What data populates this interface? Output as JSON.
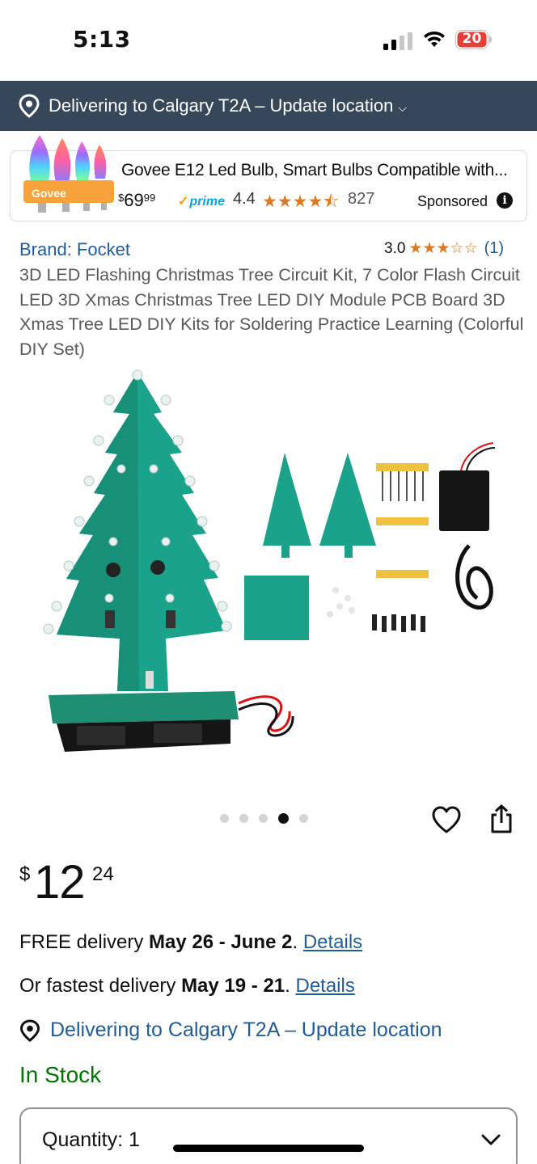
{
  "status_bar": {
    "time": "5:13",
    "battery": "20",
    "icons": [
      "signal-icon",
      "wifi-icon",
      "battery-icon"
    ]
  },
  "location_bar": {
    "text": "Delivering to Calgary T2A – Update location",
    "icon": "location-pin-icon"
  },
  "sponsored_ad": {
    "title": "Govee E12 Led Bulb, Smart Bulbs Compatible with...",
    "price_symbol": "$",
    "price_whole": "69",
    "price_cents": "99",
    "prime": "prime",
    "rating": "4.4",
    "stars": "★★★★⯪",
    "review_count": "827",
    "label": "Sponsored",
    "image_brand": "Govee"
  },
  "product": {
    "brand": "Brand: Focket",
    "rating": "3.0",
    "stars": "★★★☆☆",
    "review_count": "(1)",
    "title": "3D LED Flashing Christmas Tree Circuit Kit, 7 Color Flash Circuit LED 3D Xmas Christmas Tree LED DIY Module PCB Board 3D Xmas Tree LED DIY Kits for Soldering Practice Learning (Colorful DIY Set)",
    "image_count": 5,
    "active_image": 4
  },
  "price": {
    "symbol": "$",
    "whole": "12",
    "fraction": "24"
  },
  "delivery": {
    "free_prefix": "FREE delivery ",
    "free_dates": "May 26 - June 2",
    "fast_prefix": "Or fastest delivery ",
    "fast_dates": "May 19 - 21",
    "details_label": "Details",
    "location": "Delivering to Calgary T2A – Update location"
  },
  "stock": "In Stock",
  "quantity": {
    "label": "Quantity:",
    "value": "1"
  },
  "colors": {
    "header_bg": "#37475a",
    "link": "#1f5d9a",
    "star": "#de7921",
    "in_stock": "#007600",
    "prime": "#00a8e1"
  }
}
